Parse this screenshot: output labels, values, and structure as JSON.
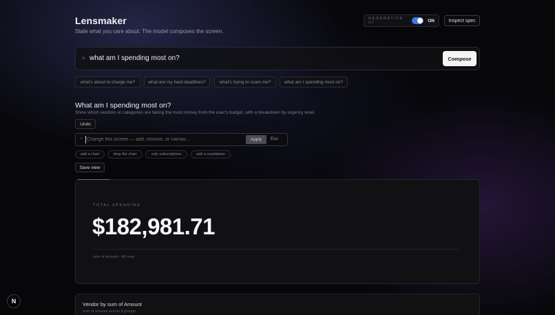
{
  "header": {
    "title": "Lensmaker",
    "subtitle": "State what you care about. The model composes the screen.",
    "generative_label": "GENERATIVE UI",
    "generative_state": "ON",
    "inspect_label": "Inspect spec"
  },
  "prompt": {
    "chevron": ">",
    "text": "what am I spending most on?",
    "compose_label": "Compose"
  },
  "suggestions": [
    "what's about to charge me?",
    "what are my hard deadlines?",
    "what's trying to scam me?",
    "what am I spending most on?"
  ],
  "section": {
    "title": "What am I spending most on?",
    "description": "Show which vendors or categories are taking the most money from the user's budget, with a breakdown by urgency level.",
    "undo_label": "Undo"
  },
  "edit": {
    "dash": "–",
    "placeholder": "Change this screen — add, remove, or narrow...",
    "apply_label": "Apply",
    "esc_label": "Esc",
    "quick_chips": [
      "add a chart",
      "drop the chart",
      "only subscriptions",
      "add a countdown"
    ],
    "save_view_label": "Save view"
  },
  "spending": {
    "label": "TOTAL SPENDING",
    "value": "$182,981.71",
    "meta": "sum of amount · 48 rows"
  },
  "vendor": {
    "title": "Vendor by sum of Amount",
    "subtitle": "sum of amount across 8 groups"
  },
  "badge": {
    "letter": "N"
  },
  "colors": {
    "accent": "#3d7be0",
    "background": "#07070a",
    "card": "#111114"
  }
}
